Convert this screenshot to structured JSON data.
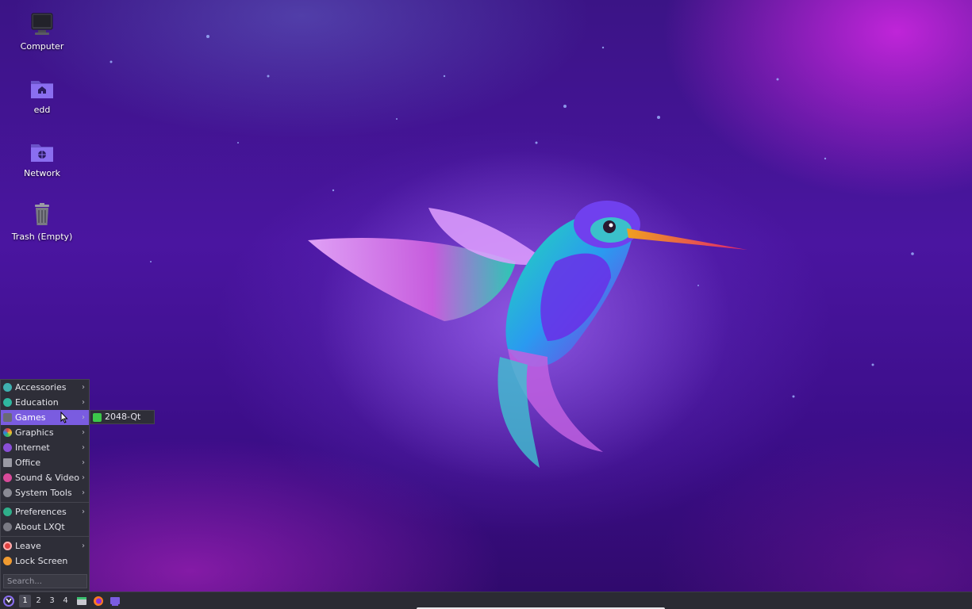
{
  "desktop": {
    "icons": [
      {
        "label": "Computer",
        "icon": "computer-icon"
      },
      {
        "label": "edd",
        "icon": "home-folder-icon"
      },
      {
        "label": "Network",
        "icon": "network-folder-icon"
      },
      {
        "label": "Trash (Empty)",
        "icon": "trash-icon"
      }
    ]
  },
  "start_menu": {
    "items": [
      {
        "label": "Accessories",
        "icon": "accessories-icon",
        "color": "#3fb0b0",
        "has_submenu": true
      },
      {
        "label": "Education",
        "icon": "education-icon",
        "color": "#2fb7a0",
        "has_submenu": true
      },
      {
        "label": "Games",
        "icon": "games-icon",
        "color": "#6a6a74",
        "has_submenu": true,
        "active": true
      },
      {
        "label": "Graphics",
        "icon": "graphics-icon",
        "color": "#e0507a",
        "has_submenu": true
      },
      {
        "label": "Internet",
        "icon": "internet-icon",
        "color": "#8a4fd8",
        "has_submenu": true
      },
      {
        "label": "Office",
        "icon": "office-icon",
        "color": "#9a9aa4",
        "has_submenu": true
      },
      {
        "label": "Sound & Video",
        "icon": "sound-video-icon",
        "color": "#d84a9a",
        "has_submenu": true
      },
      {
        "label": "System Tools",
        "icon": "system-tools-icon",
        "color": "#8a8a94",
        "has_submenu": true
      },
      {
        "label": "Preferences",
        "icon": "preferences-icon",
        "color": "#2fae8a",
        "has_submenu": true
      },
      {
        "label": "About LXQt",
        "icon": "about-icon",
        "color": "#7a7a84",
        "has_submenu": false
      },
      {
        "label": "Leave",
        "icon": "leave-icon",
        "color": "#e04040",
        "has_submenu": true
      },
      {
        "label": "Lock Screen",
        "icon": "lock-screen-icon",
        "color": "#f09a30",
        "has_submenu": false
      }
    ],
    "search_placeholder": "Search...",
    "arrow": "›"
  },
  "games_submenu": {
    "items": [
      {
        "label": "2048-Qt",
        "icon": "2048-qt-icon",
        "color": "#3cc84a"
      }
    ]
  },
  "taskbar": {
    "desktops": [
      "1",
      "2",
      "3",
      "4"
    ],
    "current_desktop": "1",
    "launchers": [
      "file-manager-icon",
      "firefox-icon",
      "terminal-icon"
    ]
  },
  "colors": {
    "menu_highlight": "#7a5ce0",
    "menu_bg": "#2e2e38",
    "panel_bg": "#2b2b33"
  }
}
